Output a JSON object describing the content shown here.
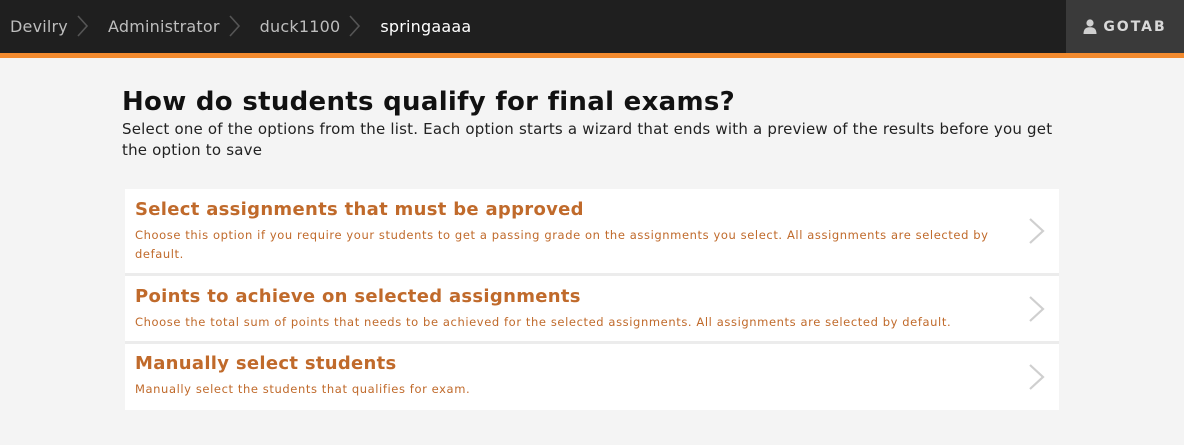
{
  "breadcrumb": {
    "items": [
      {
        "label": "Devilry"
      },
      {
        "label": "Administrator"
      },
      {
        "label": "duck1100"
      },
      {
        "label": "springaaaa"
      }
    ]
  },
  "user": {
    "label": "GOTAB",
    "icon": "user-icon"
  },
  "main": {
    "title": "How do students qualify for final exams?",
    "description": "Select one of the options from the list. Each option starts a wizard that ends with a preview of the results before you get the option to save"
  },
  "options": [
    {
      "title": "Select assignments that must be approved",
      "description": "Choose this option if you require your students to get a passing grade on the assignments you select. All assignments are selected by default."
    },
    {
      "title": "Points to achieve on selected assignments",
      "description": "Choose the total sum of points that needs to be achieved for the selected assignments. All assignments are selected by default."
    },
    {
      "title": "Manually select students",
      "description": "Manually select the students that qualifies for exam."
    }
  ],
  "colors": {
    "topbar": "#1f1f1f",
    "accent": "#f28a2e",
    "option_text": "#c06a2b"
  }
}
